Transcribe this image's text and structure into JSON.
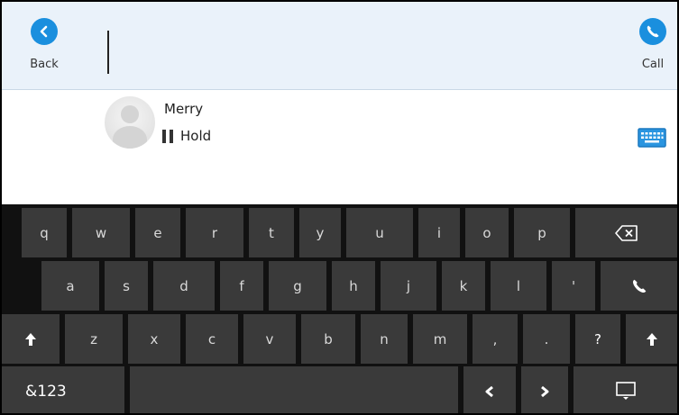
{
  "header": {
    "back_label": "Back",
    "call_label": "Call",
    "accent_color": "#1a8fde"
  },
  "call": {
    "contact_name": "Merry",
    "status": "Hold"
  },
  "keyboard": {
    "row1": [
      "q",
      "w",
      "e",
      "r",
      "t",
      "y",
      "u",
      "i",
      "o",
      "p"
    ],
    "row2": [
      "a",
      "s",
      "d",
      "f",
      "g",
      "h",
      "j",
      "k",
      "l",
      "'"
    ],
    "row3": [
      "z",
      "x",
      "c",
      "v",
      "b",
      "n",
      "m",
      ",",
      ".",
      "?"
    ],
    "symbols_label": "&123"
  },
  "icons": {
    "back": "chevron-left-icon",
    "call": "phone-icon",
    "backspace": "backspace-icon",
    "shift": "shift-arrow-icon",
    "keyboard": "keyboard-icon",
    "hide_keyboard": "hide-keyboard-icon"
  }
}
